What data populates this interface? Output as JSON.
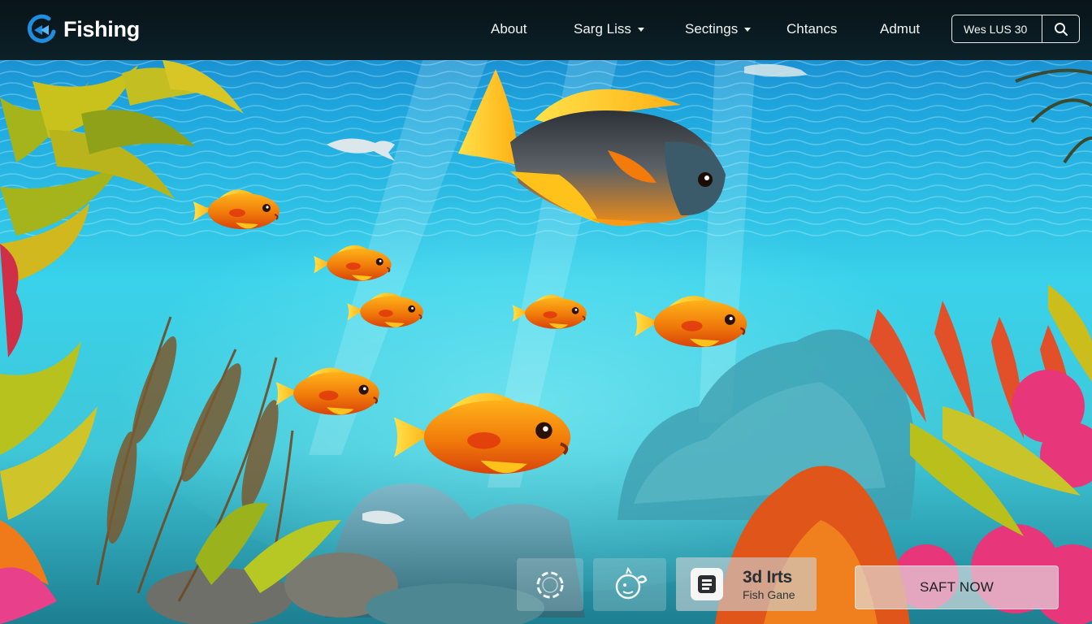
{
  "app": {
    "brand_title": "Fishing",
    "logo_icon": "fish-hook-logo-icon"
  },
  "nav": {
    "items": [
      {
        "label": "About",
        "has_dropdown": false
      },
      {
        "label": "Sarg Liss",
        "has_dropdown": true
      },
      {
        "label": "Sectings",
        "has_dropdown": true
      },
      {
        "label": "Chtancs",
        "has_dropdown": false
      },
      {
        "label": "Admut",
        "has_dropdown": false
      }
    ],
    "dropdown_icon": "caret-down-icon"
  },
  "search": {
    "value": "Wes LUS 30",
    "button_icon": "search-icon"
  },
  "bottom_bar": {
    "tile_1_icon": "ring-loader-icon",
    "tile_2_icon": "fish-hook-character-icon",
    "game_card": {
      "icon": "document-lines-icon",
      "title": "3d Irts",
      "subtitle": "Fish Gane"
    },
    "start_button_label": "SAFT NOW"
  },
  "colors": {
    "nav_bg": "#0a1416",
    "water_top": "#1f9fd9",
    "water_mid": "#33cde6",
    "fish_orange": "#f27b0c",
    "fish_yellow": "#ffc21a",
    "text_light": "#f1f4f4"
  }
}
